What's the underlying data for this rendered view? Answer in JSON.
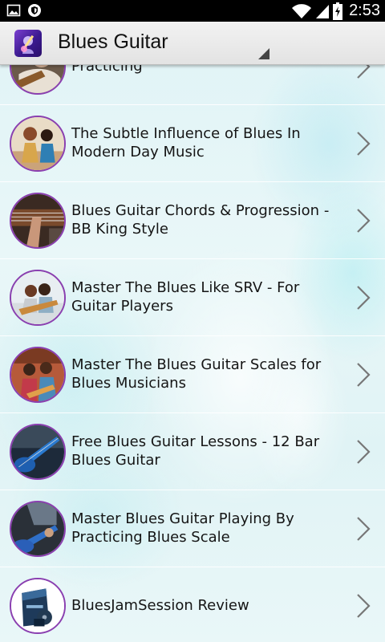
{
  "status_bar": {
    "left_icons": [
      "image-icon",
      "shield-icon"
    ],
    "right_icons": [
      "wifi-icon",
      "signal-icon",
      "battery-charging-icon"
    ],
    "time": "2:53"
  },
  "action_bar": {
    "title": "Blues Guitar",
    "icon": "guitar-app-icon"
  },
  "list": {
    "items": [
      {
        "title": "Practicing",
        "thumb_icon": "guitarist-thumb"
      },
      {
        "title": "The Subtle Influence of Blues In Modern Day Music",
        "thumb_icon": "two-musicians-thumb"
      },
      {
        "title": "Blues Guitar Chords & Progression - BB King Style",
        "thumb_icon": "guitar-neck-thumb"
      },
      {
        "title": "Master The Blues Like SRV - For Guitar Players",
        "thumb_icon": "couple-guitar-thumb"
      },
      {
        "title": "Master The Blues Guitar Scales for Blues Musicians",
        "thumb_icon": "friends-guitar-thumb"
      },
      {
        "title": "Free Blues Guitar Lessons - 12 Bar Blues Guitar",
        "thumb_icon": "blue-guitar-thumb"
      },
      {
        "title": "Master Blues Guitar Playing By Practicing Blues Scale",
        "thumb_icon": "bass-player-thumb"
      },
      {
        "title": "BluesJamSession Review",
        "thumb_icon": "product-box-thumb"
      }
    ]
  },
  "colors": {
    "thumb_border": "#8a3fb0",
    "action_bar": "#e9e9e9",
    "background": "#e3f4f6"
  }
}
